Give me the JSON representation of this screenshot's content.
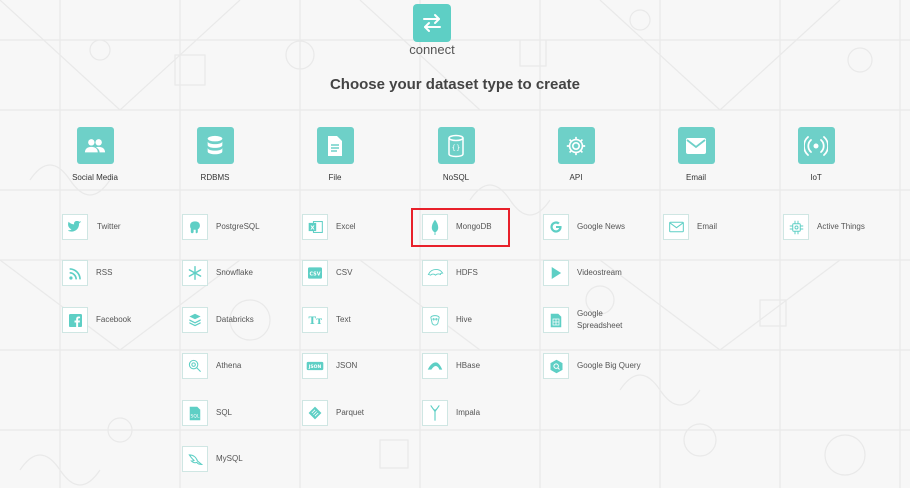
{
  "header": {
    "logo_text": "connect",
    "heading": "Choose your dataset type to create"
  },
  "colors": {
    "accent": "#5ecfc5",
    "highlight": "#e8202a"
  },
  "categories": [
    {
      "label": "Social Media",
      "icon": "users-icon"
    },
    {
      "label": "RDBMS",
      "icon": "database-icon"
    },
    {
      "label": "File",
      "icon": "file-icon"
    },
    {
      "label": "NoSQL",
      "icon": "nosql-database-icon"
    },
    {
      "label": "API",
      "icon": "gear-icon"
    },
    {
      "label": "Email",
      "icon": "envelope-icon"
    },
    {
      "label": "IoT",
      "icon": "broadcast-icon"
    }
  ],
  "social": [
    {
      "label": "Twitter",
      "icon": "twitter-icon"
    },
    {
      "label": "RSS",
      "icon": "rss-icon"
    },
    {
      "label": "Facebook",
      "icon": "facebook-icon"
    }
  ],
  "rdbms": [
    {
      "label": "PostgreSQL",
      "icon": "postgresql-icon"
    },
    {
      "label": "Snowflake",
      "icon": "snowflake-icon"
    },
    {
      "label": "Databricks",
      "icon": "databricks-icon"
    },
    {
      "label": "Athena",
      "icon": "athena-icon"
    },
    {
      "label": "SQL",
      "icon": "sql-icon"
    },
    {
      "label": "MySQL",
      "icon": "mysql-icon"
    }
  ],
  "file": [
    {
      "label": "Excel",
      "icon": "excel-icon"
    },
    {
      "label": "CSV",
      "icon": "csv-icon"
    },
    {
      "label": "Text",
      "icon": "text-icon"
    },
    {
      "label": "JSON",
      "icon": "json-icon"
    },
    {
      "label": "Parquet",
      "icon": "parquet-icon"
    }
  ],
  "nosql": [
    {
      "label": "MongoDB",
      "icon": "mongodb-icon"
    },
    {
      "label": "HDFS",
      "icon": "hdfs-icon"
    },
    {
      "label": "Hive",
      "icon": "hive-icon"
    },
    {
      "label": "HBase",
      "icon": "hbase-icon"
    },
    {
      "label": "Impala",
      "icon": "impala-icon"
    }
  ],
  "api": [
    {
      "label": "Google News",
      "icon": "google-icon"
    },
    {
      "label": "Videostream",
      "icon": "play-icon"
    },
    {
      "label": "Google Spreadsheet",
      "icon": "spreadsheet-icon"
    },
    {
      "label": "Google Big Query",
      "icon": "bigquery-icon"
    }
  ],
  "email": [
    {
      "label": "Email",
      "icon": "envelope-icon"
    }
  ],
  "iot": [
    {
      "label": "Active Things",
      "icon": "chip-icon"
    }
  ]
}
